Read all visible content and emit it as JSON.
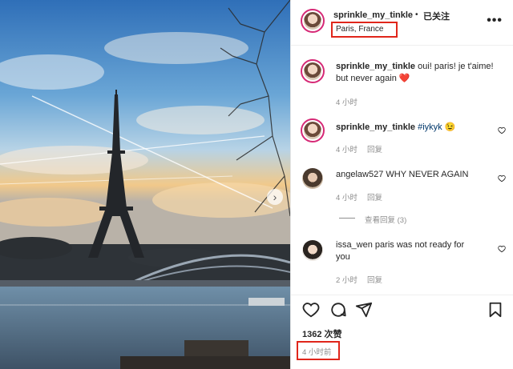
{
  "post": {
    "username": "sprinkle_my_tinkle",
    "separator": "•",
    "follow_status": "已关注",
    "location": "Paris, France",
    "more": "•••"
  },
  "caption": {
    "username": "sprinkle_my_tinkle",
    "text": "oui! paris! je t'aime! but never again",
    "emoji": "❤️",
    "time": "4 小时"
  },
  "comments": [
    {
      "username": "sprinkle_my_tinkle",
      "hashtag": "#iykyk",
      "emoji": "😉",
      "time": "4 小时",
      "reply": "回复"
    },
    {
      "username": "angelaw527",
      "text": "WHY NEVER AGAIN",
      "time": "4 小时",
      "reply": "回复",
      "view_replies": "查看回复 (3)"
    },
    {
      "username": "issa_wen",
      "text": "paris was not ready for you",
      "time": "2 小时",
      "reply": "回复"
    }
  ],
  "actions": {
    "likes": "1362 次赞",
    "timestamp": "4 小时前"
  },
  "colors": {
    "highlight_box": "#e0261b",
    "link": "#00376b",
    "story_ring": "#d62976"
  },
  "icons": [
    "heart-icon",
    "comment-icon",
    "share-icon",
    "bookmark-icon",
    "more-icon",
    "chevron-right-icon"
  ]
}
